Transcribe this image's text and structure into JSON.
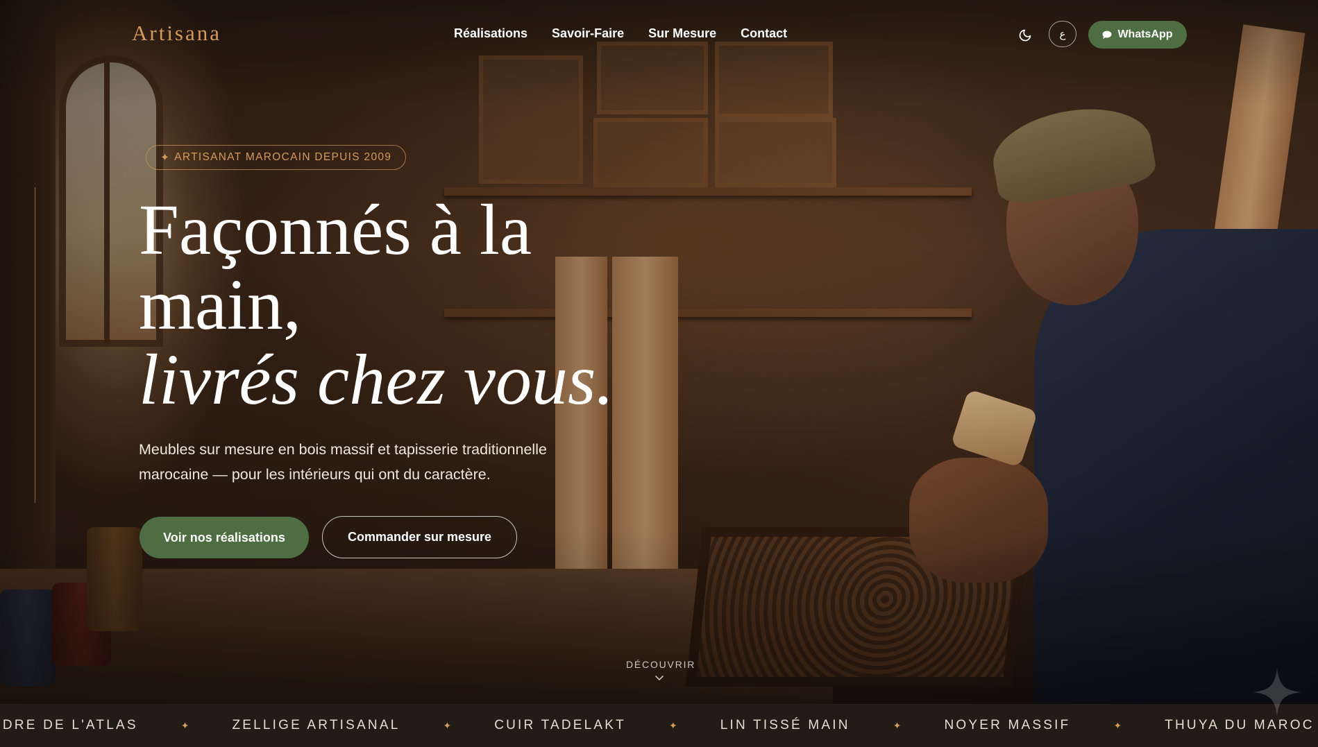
{
  "header": {
    "logo": "Artisana",
    "nav": [
      {
        "label": "Réalisations"
      },
      {
        "label": "Savoir-Faire"
      },
      {
        "label": "Sur Mesure"
      },
      {
        "label": "Contact"
      }
    ],
    "theme_icon": "moon-icon",
    "lang_label": "ع",
    "whatsapp_label": "WhatsApp",
    "whatsapp_icon": "chat-bubble-icon"
  },
  "hero": {
    "badge_icon": "✦",
    "badge": "ARTISANAT MAROCAIN DEPUIS 2009",
    "title_line1": "Façonnés à la",
    "title_line2": "main,",
    "title_line3": "livrés chez vous.",
    "subtitle_line1": "Meubles sur mesure en bois massif et tapisserie traditionnelle",
    "subtitle_line2": "marocaine — pour les intérieurs qui ont du caractère.",
    "cta_primary": "Voir nos réalisations",
    "cta_secondary": "Commander sur mesure",
    "scroll_label": "DÉCOUVRIR",
    "scroll_icon": "chevron-down-icon"
  },
  "marquee": {
    "separator": "✦",
    "items": [
      "ÈDRE DE L'ATLAS",
      "ZELLIGE ARTISANAL",
      "CUIR TADELAKT",
      "LIN TISSÉ MAIN",
      "NOYER MASSIF",
      "THUYA DU MAROC"
    ]
  },
  "colors": {
    "accent": "#d59a5c",
    "primary_button": "#4f6d43",
    "marquee_bg": "#221c17"
  }
}
